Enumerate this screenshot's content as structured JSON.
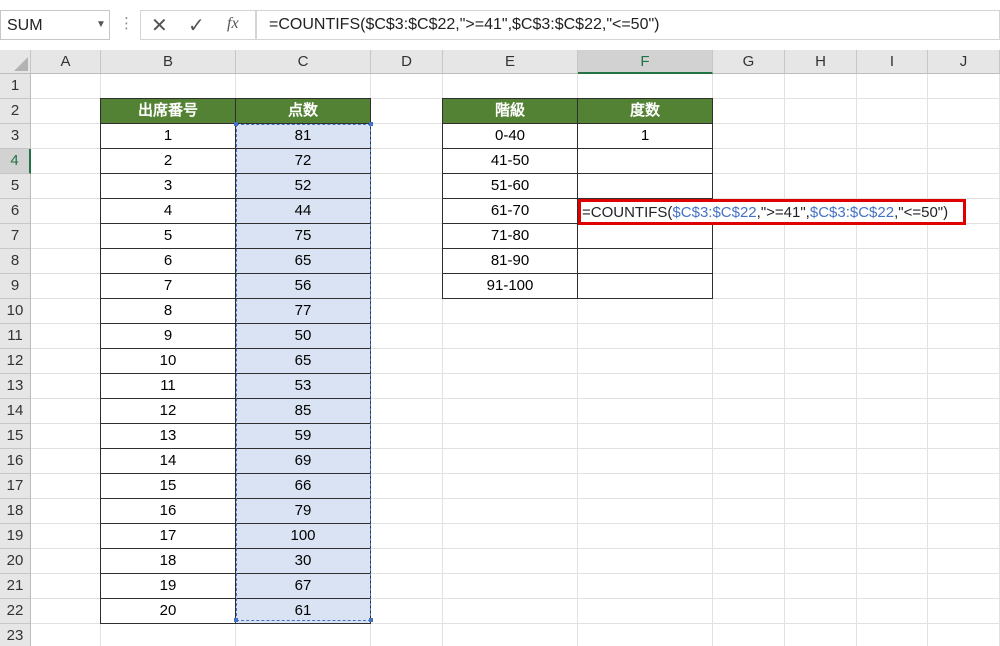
{
  "formula_bar": {
    "name_box": "SUM",
    "cancel_icon": "✕",
    "enter_icon": "✓",
    "fx_label": "fx",
    "formula": "=COUNTIFS($C$3:$C$22,\">=41\",$C$3:$C$22,\"<=50\")"
  },
  "columns": [
    "A",
    "B",
    "C",
    "D",
    "E",
    "F",
    "G",
    "H",
    "I",
    "J"
  ],
  "rows": [
    "1",
    "2",
    "3",
    "4",
    "5",
    "6",
    "7",
    "8",
    "9",
    "10",
    "11",
    "12",
    "13",
    "14",
    "15",
    "16",
    "17",
    "18",
    "19",
    "20",
    "21",
    "22",
    "23"
  ],
  "table1": {
    "headers": [
      "出席番号",
      "点数"
    ],
    "rows": [
      [
        "1",
        "81"
      ],
      [
        "2",
        "72"
      ],
      [
        "3",
        "52"
      ],
      [
        "4",
        "44"
      ],
      [
        "5",
        "75"
      ],
      [
        "6",
        "65"
      ],
      [
        "7",
        "56"
      ],
      [
        "8",
        "77"
      ],
      [
        "9",
        "50"
      ],
      [
        "10",
        "65"
      ],
      [
        "11",
        "53"
      ],
      [
        "12",
        "85"
      ],
      [
        "13",
        "59"
      ],
      [
        "14",
        "69"
      ],
      [
        "15",
        "66"
      ],
      [
        "16",
        "79"
      ],
      [
        "17",
        "100"
      ],
      [
        "18",
        "30"
      ],
      [
        "19",
        "67"
      ],
      [
        "20",
        "61"
      ]
    ]
  },
  "table2": {
    "headers": [
      "階級",
      "度数"
    ],
    "rows": [
      [
        "0-40",
        "1"
      ],
      [
        "41-50",
        ""
      ],
      [
        "51-60",
        ""
      ],
      [
        "61-70",
        ""
      ],
      [
        "71-80",
        ""
      ],
      [
        "81-90",
        ""
      ],
      [
        "91-100",
        ""
      ]
    ]
  },
  "editing_cell": {
    "prefix": "=COUNTIFS(",
    "ref1": "$C$3:$C$22",
    "mid": ",\">=41\",",
    "ref2": "$C$3:$C$22",
    "suffix": ",\"<=50\")"
  },
  "colors": {
    "header_fill": "#548235",
    "selection_fill": "#dae3f3",
    "reference_blue": "#4472c4",
    "highlight_red": "#e00000",
    "excel_green": "#217346"
  }
}
